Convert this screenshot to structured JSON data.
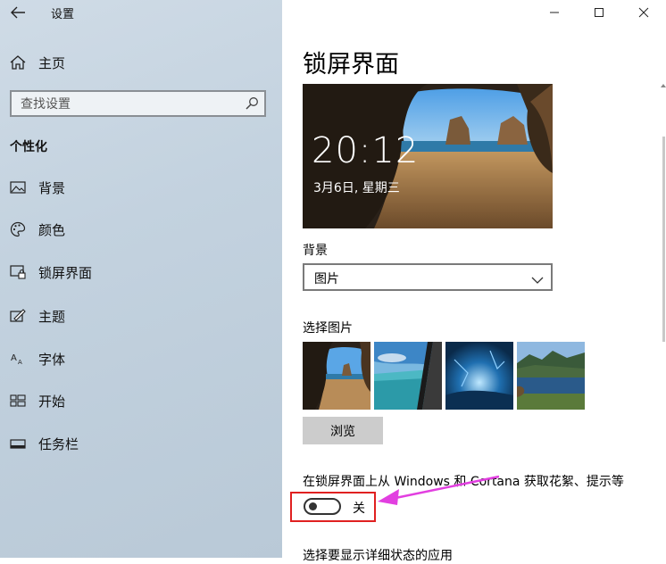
{
  "app": {
    "title": "设置"
  },
  "sidebar": {
    "home_label": "主页",
    "search_placeholder": "查找设置",
    "section_title": "个性化",
    "items": [
      {
        "label": "背景",
        "icon": "picture-icon"
      },
      {
        "label": "颜色",
        "icon": "palette-icon"
      },
      {
        "label": "锁屏界面",
        "icon": "lock-screen-icon"
      },
      {
        "label": "主题",
        "icon": "theme-icon"
      },
      {
        "label": "字体",
        "icon": "font-icon"
      },
      {
        "label": "开始",
        "icon": "start-icon"
      },
      {
        "label": "任务栏",
        "icon": "taskbar-icon"
      }
    ]
  },
  "main": {
    "page_title": "锁屏界面",
    "preview": {
      "time": "20:12",
      "date": "3月6日, 星期三"
    },
    "background_label": "背景",
    "background_value": "图片",
    "choose_picture_label": "选择图片",
    "browse_label": "浏览",
    "fun_facts_label": "在锁屏界面上从 Windows 和 Cortana 获取花絮、提示等",
    "toggle_state_label": "关",
    "cut_text": "选择要显示详细状态的应用"
  },
  "colors": {
    "highlight": "#e02020",
    "arrow": "#e23fe0",
    "accent": "#0078d7"
  }
}
